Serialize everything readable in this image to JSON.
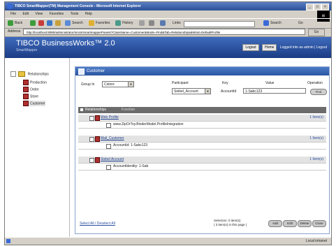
{
  "window": {
    "title": "TIBCO SmartMapper(TM) Management Console - Microsoft Internet Explorer"
  },
  "menu": [
    "File",
    "Edit",
    "View",
    "Favorites",
    "Tools",
    "Help"
  ],
  "toolbar": {
    "back": "Back",
    "search": "Search",
    "favorites": "Favorites",
    "history": "History",
    "go": "Go",
    "links": "Links"
  },
  "address": {
    "label": "Address",
    "value": "http://localhost:8080/administrator/smUI/smartmapperPanels?ClassName=Customer&Mode=Find&Tab=Relationships&Wind=DefaultProfile",
    "go": "Go"
  },
  "banner": {
    "product": "TIBCO BusinessWorks™ 2.0",
    "sub": "SmartMapper",
    "logout": "Logout",
    "home": "Home",
    "logged_in": "Logged into as admin | Logout"
  },
  "sidebar": {
    "root": "Relationships",
    "items": [
      "Production",
      "Order",
      "Store",
      "Customer"
    ]
  },
  "panel": {
    "title": "Customer",
    "group_label": "Group In",
    "group_value": "Cstore",
    "participant_header": "Participant",
    "key_header": "Key",
    "value_header": "Value",
    "operation_header": "Operation",
    "participant_value": "Siebel_Account",
    "key_value": "AccountId",
    "value_value": "1-Sabc123",
    "find_button": "Find",
    "relationships_label": "Relationships",
    "relationships_sub": "Function",
    "rows": [
      {
        "kind": "group",
        "label": "Web Profile",
        "link": "1 Item(s)"
      },
      {
        "kind": "item",
        "label": "www.ZipOrToy.BinderModel.ProfileIntegration"
      },
      {
        "kind": "group",
        "label": "Mail_Customer",
        "link": "1 Item(s)"
      },
      {
        "kind": "item",
        "label": "AccountId: 1-Sabc123"
      },
      {
        "kind": "group",
        "label": "Siebel Account",
        "link": "1 Item(s)"
      },
      {
        "kind": "item",
        "label": "AccountIdentity: 1-Sab"
      }
    ],
    "footer_left": "Select All / Deselect All",
    "footer_mid_1": "Selection: 0 item(s)",
    "footer_mid_2": "( 3 item(s) in this page )",
    "footer_buttons": [
      "Add",
      "Edit",
      "Delete",
      "Close"
    ]
  },
  "status": {
    "text": "Local intranet"
  }
}
